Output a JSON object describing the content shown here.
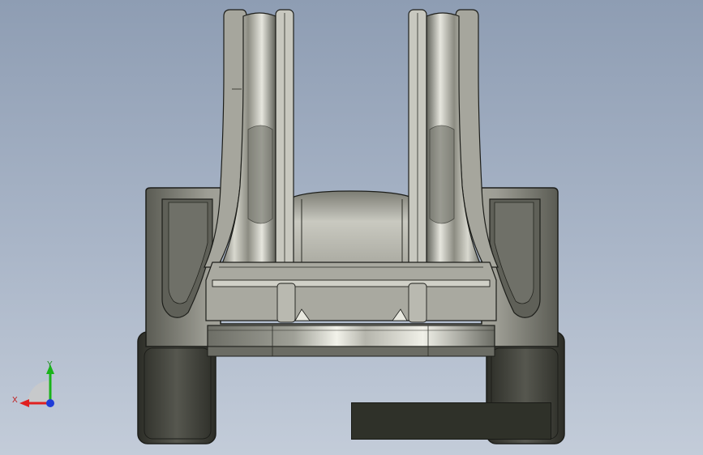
{
  "viewport": {
    "background_top": "#8e9db3",
    "background_bottom": "#c3ccd9",
    "model_body_color": "#b9b8ae",
    "model_shadow_color": "#5d5e56",
    "model_dark_color": "#2f3129",
    "edge_color": "#1d1e1a"
  },
  "triad": {
    "x_label": "X",
    "y_label": "Y",
    "x_color": "#e02020",
    "y_color": "#19b319",
    "z_color": "#1f3cd8"
  }
}
